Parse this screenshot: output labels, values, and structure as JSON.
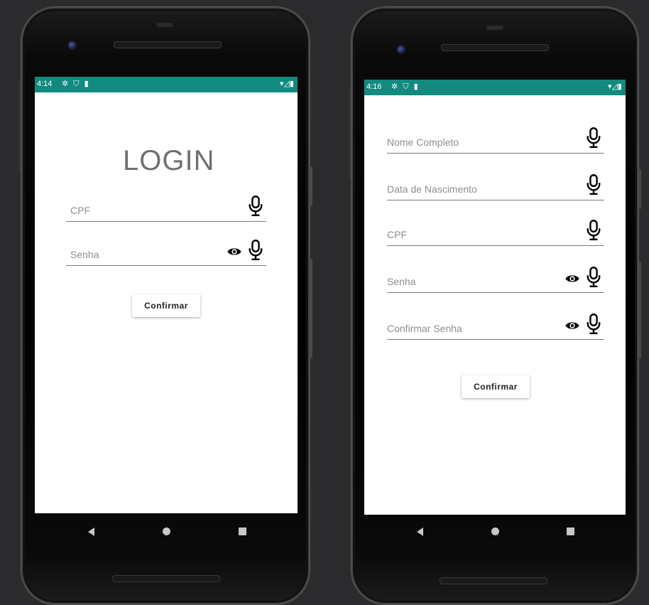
{
  "login_screen": {
    "status": {
      "time": "4:14",
      "left_icons": "✲ ⛉ ▮",
      "right_icons": "▾◿▮"
    },
    "title": "LOGIN",
    "fields": [
      {
        "label": "CPF",
        "has_eye": false
      },
      {
        "label": "Senha",
        "has_eye": true
      }
    ],
    "confirm_label": "Confirmar"
  },
  "register_screen": {
    "status": {
      "time": "4:16",
      "left_icons": "✲ ⛉ ▮",
      "right_icons": "▾◿▮"
    },
    "fields": [
      {
        "label": "Nome Completo",
        "has_eye": false
      },
      {
        "label": "Data de Nascimento",
        "has_eye": false
      },
      {
        "label": "CPF",
        "has_eye": false
      },
      {
        "label": "Senha",
        "has_eye": true
      },
      {
        "label": "Confirmar Senha",
        "has_eye": true
      }
    ],
    "confirm_label": "Confirmar"
  },
  "icons": {
    "mic": "mic-icon",
    "eye": "eye-icon"
  },
  "colors": {
    "status_bar": "#128a80",
    "background": "#2b2b2d"
  }
}
